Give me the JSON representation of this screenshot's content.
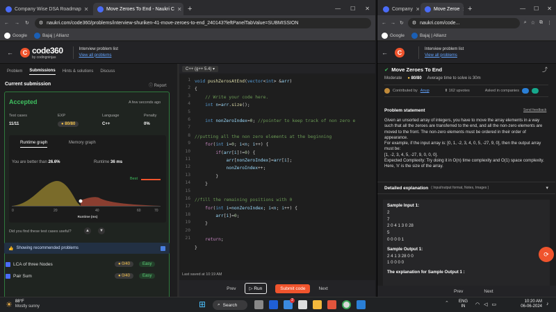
{
  "left_window": {
    "tabs": [
      {
        "label": "Company Wise DSA Roadmap"
      },
      {
        "label": "Move Zeroes To End - Naukri C"
      }
    ],
    "url": "naukri.com/code360/problems/interview-shuriken-41-move-zeroes-to-end_240143?leftPanelTabValue=SUBMISSION",
    "bookmarks": [
      "Google",
      "Bajaj | Allianz"
    ],
    "brand": {
      "name": "code360",
      "sub": "by codingninjas"
    },
    "interview": {
      "title": "Interview problem list",
      "link": "View all problems"
    },
    "problem_tabs": [
      "Problem",
      "Submissions",
      "Hints & solutions",
      "Discuss"
    ],
    "submission": {
      "heading": "Current submission",
      "report": "Report",
      "status": "Accepted",
      "time_ago": "A few seconds ago",
      "test_cases_label": "Test cases",
      "test_cases": "11/11",
      "exp_label": "EXP",
      "exp": "80/80",
      "language_label": "Language",
      "language": "C++",
      "penalty_label": "Penalty",
      "penalty": "0%",
      "graph_tabs": [
        "Runtime graph",
        "Memory graph"
      ],
      "better_prefix": "You are better than",
      "better_value": "26.6%",
      "runtime_label": "Runtime",
      "runtime_value": "36 ms",
      "best_label": "Best",
      "x_axis_label": "Runtime (ms)",
      "x_ticks": [
        "0",
        "20",
        "40",
        "60",
        "70"
      ],
      "useful": "Did you find these test cases useful?"
    },
    "recommended": {
      "label": "Showing recommended problems",
      "items": [
        {
          "name": "LCA of three Nodes",
          "exp": "0/40",
          "level": "Easy"
        },
        {
          "name": "Pair Sum",
          "exp": "0/40",
          "level": "Easy"
        }
      ]
    },
    "editor": {
      "language": "C++ (g++ 5.4)",
      "line_numbers": [
        "1",
        "2",
        "3",
        "4",
        "5",
        "6",
        "7",
        "8",
        "9",
        "10",
        "11",
        "12",
        "13",
        "14",
        "15",
        "16",
        "17",
        "18",
        "19",
        "20",
        "21"
      ],
      "saved": "Last saved at 10:19 AM"
    },
    "footer": {
      "prev": "Prev",
      "run": "Run",
      "submit": "Submit code",
      "next": "Next"
    }
  },
  "right_window": {
    "tabs": [
      {
        "label": "Company"
      },
      {
        "label": "Move Zeroe"
      }
    ],
    "url": "naukri.com/code...",
    "bookmarks": [
      "Google",
      "Bajaj | Allianz"
    ],
    "interview": {
      "title": "Interview problem list",
      "link": "View all problems"
    },
    "problem": {
      "title": "Move Zeroes To End",
      "difficulty": "Moderate",
      "exp": "80/80",
      "avg_time": "Average time to solve is 30m",
      "contributed_prefix": "Contributed by",
      "contributor": "Anup",
      "upvotes": "162 upvotes",
      "asked": "Asked in companies",
      "statement_heading": "Problem statement",
      "send_feedback": "Send feedback",
      "statement": "Given an unsorted array of integers, you have to move the array elements in a way such that all the zeroes are transferred to the end, and all the non-zero elements are moved to the front. The non-zero elements must be ordered in their order of appearance.",
      "example": "For example, if the input array is: [0, 1, -2, 3, 4, 0, 5, -27, 9, 0], then the output array must be:",
      "example_out": "[1, -2, 3, 4, 5, -27, 9, 0, 0, 0].",
      "complexity": "Expected Complexity: Try doing it in O(n) time complexity and O(1) space complexity. Here, 'n' is the size of the array.",
      "detailed": "Detailed explanation",
      "detailed_sub": "( Input/output format, Notes, Images )",
      "sample_in_label": "Sample Input 1:",
      "sample_in": [
        "2",
        "7",
        "2 0 4 1 3 0 28",
        "5",
        "0 0 0 0 1"
      ],
      "sample_out_label": "Sample Output 1:",
      "sample_out": [
        "2 4 1 3 28 0 0",
        "1 0 0 0 0"
      ],
      "explanation_label": "The explanation for Sample Output 1 :"
    },
    "footer": {
      "prev": "Prev",
      "next": "Next"
    }
  },
  "taskbar": {
    "temp": "88°F",
    "weather": "Mostly sunny",
    "search": "Search",
    "lang1": "ENG",
    "lang2": "IN",
    "time": "10:20 AM",
    "date": "06-06-2024",
    "badge": "2"
  },
  "colors": {
    "accent": "#f0542d",
    "accepted": "#3fbf5f",
    "link": "#63a4ff"
  }
}
